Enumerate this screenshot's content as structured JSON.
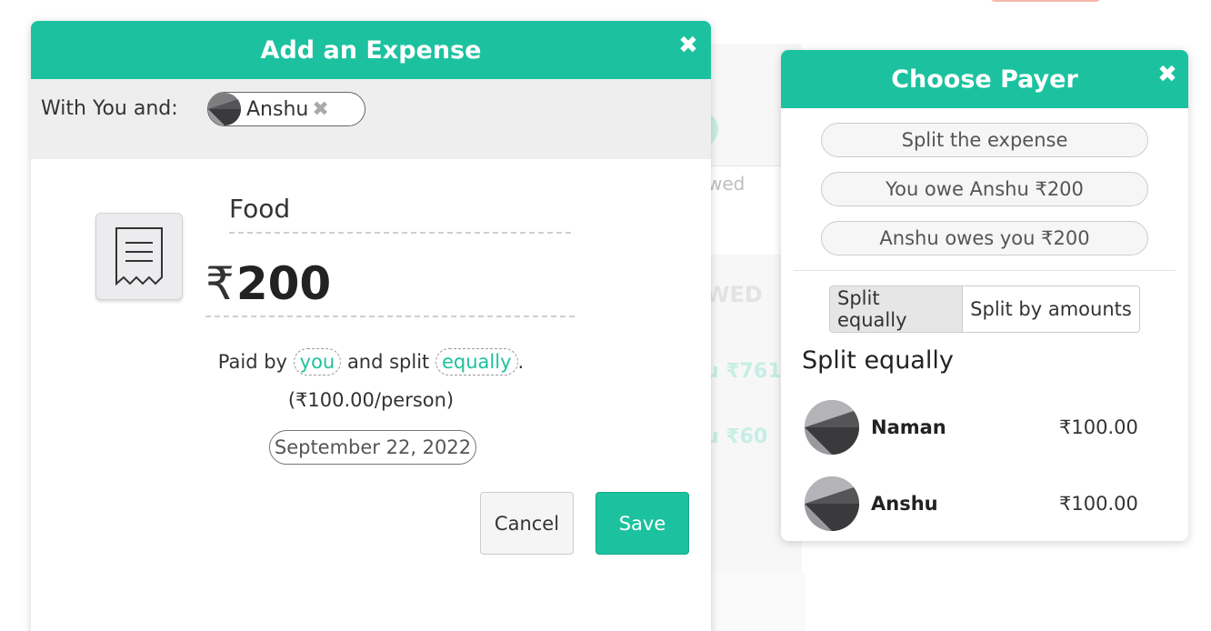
{
  "background": {
    "owed_text": "wed",
    "heading_fragment": "WED",
    "amount1": "u ₹761",
    "amount2": "u ₹60"
  },
  "expense_modal": {
    "title": "Add an Expense",
    "close_glyph": "✖",
    "with_label": "With You and:",
    "participant_chip": {
      "name": "Anshu",
      "remove_glyph": "✖"
    },
    "description": "Food",
    "currency_symbol": "₹",
    "amount": "200",
    "paid_by_prefix": "Paid by",
    "paid_by_value": "you",
    "split_middle": "and split",
    "split_value": "equally",
    "split_suffix": ".",
    "per_person": "(₹100.00/person)",
    "date": "September 22, 2022",
    "cancel_label": "Cancel",
    "save_label": "Save"
  },
  "payer_panel": {
    "title": "Choose Payer",
    "close_glyph": "✖",
    "options": [
      {
        "label": "Split the expense"
      },
      {
        "label": "You owe Anshu ₹200"
      },
      {
        "label": "Anshu owes you ₹200"
      }
    ],
    "segmented": {
      "equal_label": "Split equally",
      "amounts_label": "Split by amounts",
      "active": "Split equally"
    },
    "split_heading": "Split equally",
    "people": [
      {
        "name": "Naman",
        "amount": "₹100.00"
      },
      {
        "name": "Anshu",
        "amount": "₹100.00"
      }
    ]
  },
  "colors": {
    "accent": "#1cc29f",
    "header_text": "#ffffff",
    "with_row_bg": "#eeeeee"
  },
  "icons": {
    "receipt": "receipt-icon",
    "avatar": "avatar-icon",
    "close": "close-icon"
  }
}
